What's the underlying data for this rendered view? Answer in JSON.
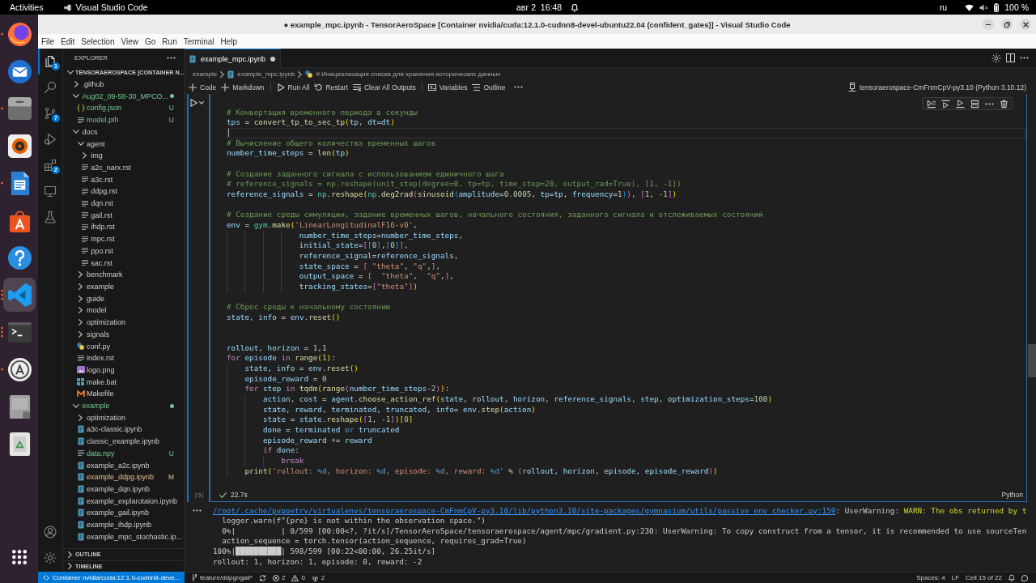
{
  "top_bar": {
    "activities": "Activities",
    "app_name": "Visual Studio Code",
    "clock": "авг 2  16:48",
    "input_source": "ru",
    "battery": "100 %"
  },
  "dock": {
    "apps": [
      {
        "selected": false,
        "running": true,
        "multiple_windows": false
      },
      {
        "selected": false,
        "running": false,
        "multiple_windows": false
      },
      {
        "selected": false,
        "running": true,
        "multiple_windows": false
      },
      {
        "selected": false,
        "running": false,
        "multiple_windows": false
      },
      {
        "selected": false,
        "running": true,
        "multiple_windows": false
      },
      {
        "selected": false,
        "running": false,
        "multiple_windows": false
      },
      {
        "selected": false,
        "running": false,
        "multiple_windows": false
      },
      {
        "selected": true,
        "running": true,
        "multiple_windows": true
      },
      {
        "selected": false,
        "running": true,
        "multiple_windows": true
      },
      {
        "selected": false,
        "running": true,
        "multiple_windows": false
      },
      {
        "selected": false,
        "running": false,
        "multiple_windows": false
      },
      {
        "selected": false,
        "running": false,
        "multiple_windows": false
      }
    ]
  },
  "window": {
    "title": "● example_mpc.ipynb - TensorAeroSpace [Container nvidia/cuda:12.1.0-cudnn8-devel-ubuntu22.04 (confident_gates)] - Visual Studio Code"
  },
  "menu_bar": [
    "File",
    "Edit",
    "Selection",
    "View",
    "Go",
    "Run",
    "Terminal",
    "Help"
  ],
  "activity_bar": {
    "items": [
      {
        "selected": true,
        "badge": "1"
      },
      {
        "selected": false
      },
      {
        "selected": false,
        "badge": "7"
      },
      {
        "selected": false
      },
      {
        "selected": false,
        "badge": "2"
      },
      {
        "selected": false
      },
      {
        "selected": false
      }
    ]
  },
  "explorer": {
    "title": "EXPLORER",
    "tree": [
      {
        "label": "TENSORAEROSPACE [CONTAINER N...",
        "kind": "root",
        "expanded": true,
        "children": [
          {
            "label": ".github",
            "kind": "folder",
            "expanded": false
          },
          {
            "label": "Aug02_09-58-30_MPCO...",
            "kind": "folder",
            "expanded": true,
            "untracked": true,
            "children": [
              {
                "label": "config.json",
                "kind": "json",
                "untracked": true,
                "decoration": "U"
              },
              {
                "label": "model.pth",
                "kind": "text",
                "untracked": true,
                "decoration": "U"
              }
            ]
          },
          {
            "label": "docs",
            "kind": "folder",
            "expanded": true,
            "children": [
              {
                "label": "agent",
                "kind": "folder",
                "expanded": true,
                "children": [
                  {
                    "label": "img",
                    "kind": "folder",
                    "expanded": false
                  },
                  {
                    "label": "a2c_narx.rst",
                    "kind": "text"
                  },
                  {
                    "label": "a3c.rst",
                    "kind": "text"
                  },
                  {
                    "label": "ddpg.rst",
                    "kind": "text"
                  },
                  {
                    "label": "dqn.rst",
                    "kind": "text"
                  },
                  {
                    "label": "gail.rst",
                    "kind": "text"
                  },
                  {
                    "label": "ihdp.rst",
                    "kind": "text"
                  },
                  {
                    "label": "mpc.rst",
                    "kind": "text"
                  },
                  {
                    "label": "ppo.rst",
                    "kind": "text"
                  },
                  {
                    "label": "sac.rst",
                    "kind": "text"
                  }
                ]
              },
              {
                "label": "benchmark",
                "kind": "folder",
                "expanded": false
              },
              {
                "label": "example",
                "kind": "folder",
                "expanded": false
              },
              {
                "label": "guide",
                "kind": "folder",
                "expanded": false
              },
              {
                "label": "model",
                "kind": "folder",
                "expanded": false
              },
              {
                "label": "optimization",
                "kind": "folder",
                "expanded": false
              },
              {
                "label": "signals",
                "kind": "folder",
                "expanded": false
              },
              {
                "label": "conf.py",
                "kind": "python"
              },
              {
                "label": "index.rst",
                "kind": "text"
              },
              {
                "label": "logo.png",
                "kind": "image"
              },
              {
                "label": "make.bat",
                "kind": "windows"
              },
              {
                "label": "Makefile",
                "kind": "make"
              }
            ]
          },
          {
            "label": "example",
            "kind": "folder",
            "expanded": true,
            "untracked": true,
            "children": [
              {
                "label": "optimization",
                "kind": "folder",
                "expanded": false
              },
              {
                "label": "a3c-classic.ipynb",
                "kind": "notebook"
              },
              {
                "label": "classic_example.ipynb",
                "kind": "notebook"
              },
              {
                "label": "data.npy",
                "kind": "text",
                "untracked": true,
                "decoration": "U"
              },
              {
                "label": "example_a2c.ipynb",
                "kind": "notebook"
              },
              {
                "label": "example_ddpg.ipynb",
                "kind": "notebook",
                "modified": true,
                "decoration": "M"
              },
              {
                "label": "example_dqn.ipynb",
                "kind": "notebook"
              },
              {
                "label": "example_explarotaion.ipynb",
                "kind": "notebook"
              },
              {
                "label": "example_gail.ipynb",
                "kind": "notebook"
              },
              {
                "label": "example_ihdp.ipynb",
                "kind": "notebook"
              },
              {
                "label": "example_mpc_stochastic.ip...",
                "kind": "notebook"
              }
            ]
          }
        ]
      }
    ],
    "sections": [
      {
        "label": "OUTLINE",
        "expanded": false
      },
      {
        "label": "TIMELINE",
        "expanded": false
      }
    ]
  },
  "editor": {
    "tabs": [
      {
        "label": "example_mpc.ipynb",
        "selected": true,
        "dirty": true
      }
    ],
    "breadcrumb": [
      {
        "label": "example",
        "kind": "folder"
      },
      {
        "label": "example_mpc.ipynb",
        "kind": "notebook"
      },
      {
        "label": "# Инициализация списка для хранения исторических данных",
        "kind": "cell"
      }
    ],
    "toolbar": {
      "groups": [
        [
          "Code",
          "Markdown"
        ],
        [
          "Run All",
          "Restart",
          "Clear All Outputs"
        ],
        [
          "Variables",
          "Outline"
        ]
      ],
      "kernel": "tensoraerospace-CmFnmCpV-py3.10 (Python 3.10.12)"
    },
    "cell": {
      "execution_count": "[9]",
      "succeeded": true,
      "duration": "22.7s",
      "language": "Python",
      "lines": [
        {
          "kind": "code",
          "segments": [
            {
              "kind": "comment",
              "text": "# Конвертация временного периода в секунды"
            }
          ]
        },
        {
          "kind": "code",
          "segments": [
            {
              "kind": "name",
              "text": "tps"
            },
            {
              "kind": "plain",
              "text": " = "
            },
            {
              "kind": "func",
              "text": "convert_tp_to_sec_tp"
            },
            {
              "kind": "bracket1",
              "text": "("
            },
            {
              "kind": "name",
              "text": "tp"
            },
            {
              "kind": "plain",
              "text": ", "
            },
            {
              "kind": "name",
              "text": "dt"
            },
            {
              "kind": "plain",
              "text": "="
            },
            {
              "kind": "name",
              "text": "dt"
            },
            {
              "kind": "bracket1",
              "text": ")"
            }
          ]
        },
        {
          "kind": "current"
        },
        {
          "kind": "code",
          "segments": [
            {
              "kind": "comment",
              "text": "# Вычисление общего количества временных шагов"
            }
          ]
        },
        {
          "kind": "code",
          "segments": [
            {
              "kind": "name",
              "text": "number_time_steps"
            },
            {
              "kind": "plain",
              "text": " = "
            },
            {
              "kind": "func",
              "text": "len"
            },
            {
              "kind": "bracket1",
              "text": "("
            },
            {
              "kind": "name",
              "text": "tp"
            },
            {
              "kind": "bracket1",
              "text": ")"
            }
          ]
        },
        {
          "kind": "blank"
        },
        {
          "kind": "code",
          "segments": [
            {
              "kind": "comment",
              "text": "# Создание заданного сигнала с использованием единичного шага"
            }
          ]
        },
        {
          "kind": "code",
          "segments": [
            {
              "kind": "comment",
              "text": "# reference_signals = np.reshape(unit_step(degree=0, tp=tp, time_step=20, output_rad=True), [1, -1])"
            }
          ]
        },
        {
          "kind": "code",
          "segments": [
            {
              "kind": "name",
              "text": "reference_signals"
            },
            {
              "kind": "plain",
              "text": " = "
            },
            {
              "kind": "module",
              "text": "np"
            },
            {
              "kind": "plain",
              "text": "."
            },
            {
              "kind": "func",
              "text": "reshape"
            },
            {
              "kind": "bracket1",
              "text": "("
            },
            {
              "kind": "module",
              "text": "np"
            },
            {
              "kind": "plain",
              "text": "."
            },
            {
              "kind": "func",
              "text": "deg2rad"
            },
            {
              "kind": "bracket2",
              "text": "("
            },
            {
              "kind": "func",
              "text": "sinusoid"
            },
            {
              "kind": "bracket3",
              "text": "("
            },
            {
              "kind": "name",
              "text": "amplitude"
            },
            {
              "kind": "plain",
              "text": "="
            },
            {
              "kind": "number",
              "text": "0.0005"
            },
            {
              "kind": "plain",
              "text": ", "
            },
            {
              "kind": "name",
              "text": "tp"
            },
            {
              "kind": "plain",
              "text": "="
            },
            {
              "kind": "name",
              "text": "tp"
            },
            {
              "kind": "plain",
              "text": ", "
            },
            {
              "kind": "name",
              "text": "frequency"
            },
            {
              "kind": "plain",
              "text": "="
            },
            {
              "kind": "number",
              "text": "1"
            },
            {
              "kind": "bracket3",
              "text": ")"
            },
            {
              "kind": "bracket2",
              "text": ")"
            },
            {
              "kind": "plain",
              "text": ", "
            },
            {
              "kind": "bracket2",
              "text": "["
            },
            {
              "kind": "number",
              "text": "1"
            },
            {
              "kind": "plain",
              "text": ", -"
            },
            {
              "kind": "number",
              "text": "1"
            },
            {
              "kind": "bracket2",
              "text": "]"
            },
            {
              "kind": "bracket1",
              "text": ")"
            }
          ]
        },
        {
          "kind": "blank"
        },
        {
          "kind": "code",
          "segments": [
            {
              "kind": "comment",
              "text": "# Создание среды симуляции, задание временных шагов, начального состояния, заданного сигнала и отслеживаемых состояний"
            }
          ]
        },
        {
          "kind": "code",
          "segments": [
            {
              "kind": "name",
              "text": "env"
            },
            {
              "kind": "plain",
              "text": " = "
            },
            {
              "kind": "module",
              "text": "gym"
            },
            {
              "kind": "plain",
              "text": "."
            },
            {
              "kind": "func",
              "text": "make"
            },
            {
              "kind": "bracket1",
              "text": "("
            },
            {
              "kind": "string",
              "text": "'LinearLongitudinalF16-v0'"
            },
            {
              "kind": "plain",
              "text": ","
            }
          ]
        },
        {
          "kind": "code",
          "segments": [
            {
              "kind": "name",
              "text": "                number_time_steps"
            },
            {
              "kind": "plain",
              "text": "="
            },
            {
              "kind": "name",
              "text": "number_time_steps"
            },
            {
              "kind": "plain",
              "text": ","
            }
          ]
        },
        {
          "kind": "code",
          "segments": [
            {
              "kind": "name",
              "text": "                initial_state"
            },
            {
              "kind": "plain",
              "text": "="
            },
            {
              "kind": "bracket2",
              "text": "["
            },
            {
              "kind": "bracket3",
              "text": "["
            },
            {
              "kind": "number",
              "text": "0"
            },
            {
              "kind": "bracket3",
              "text": "]"
            },
            {
              "kind": "plain",
              "text": ","
            },
            {
              "kind": "bracket3",
              "text": "["
            },
            {
              "kind": "number",
              "text": "0"
            },
            {
              "kind": "bracket3",
              "text": "]"
            },
            {
              "kind": "bracket2",
              "text": "]"
            },
            {
              "kind": "plain",
              "text": ","
            }
          ]
        },
        {
          "kind": "code",
          "segments": [
            {
              "kind": "name",
              "text": "                reference_signal"
            },
            {
              "kind": "plain",
              "text": "="
            },
            {
              "kind": "name",
              "text": "reference_signals"
            },
            {
              "kind": "plain",
              "text": ","
            }
          ]
        },
        {
          "kind": "code",
          "segments": [
            {
              "kind": "name",
              "text": "                state_space"
            },
            {
              "kind": "plain",
              "text": " = "
            },
            {
              "kind": "bracket2",
              "text": "[ "
            },
            {
              "kind": "string",
              "text": "\"theta\""
            },
            {
              "kind": "plain",
              "text": ", "
            },
            {
              "kind": "string",
              "text": "\"q\""
            },
            {
              "kind": "plain",
              "text": ","
            },
            {
              "kind": "bracket2",
              "text": "]"
            },
            {
              "kind": "plain",
              "text": ","
            }
          ]
        },
        {
          "kind": "code",
          "segments": [
            {
              "kind": "name",
              "text": "                output_space"
            },
            {
              "kind": "plain",
              "text": " = "
            },
            {
              "kind": "bracket2",
              "text": "[  "
            },
            {
              "kind": "string",
              "text": "\"theta\""
            },
            {
              "kind": "plain",
              "text": ",  "
            },
            {
              "kind": "string",
              "text": "\"q\""
            },
            {
              "kind": "plain",
              "text": ","
            },
            {
              "kind": "bracket2",
              "text": "]"
            },
            {
              "kind": "plain",
              "text": ","
            }
          ]
        },
        {
          "kind": "code",
          "segments": [
            {
              "kind": "name",
              "text": "                tracking_states"
            },
            {
              "kind": "plain",
              "text": "="
            },
            {
              "kind": "bracket2",
              "text": "["
            },
            {
              "kind": "string",
              "text": "\"theta\""
            },
            {
              "kind": "bracket2",
              "text": "]"
            },
            {
              "kind": "bracket1",
              "text": ")"
            }
          ]
        },
        {
          "kind": "blank"
        },
        {
          "kind": "code",
          "segments": [
            {
              "kind": "comment",
              "text": "# Сброс среды к начальному состоянию"
            }
          ]
        },
        {
          "kind": "code",
          "segments": [
            {
              "kind": "name",
              "text": "state"
            },
            {
              "kind": "plain",
              "text": ", "
            },
            {
              "kind": "name",
              "text": "info"
            },
            {
              "kind": "plain",
              "text": " = "
            },
            {
              "kind": "name",
              "text": "env"
            },
            {
              "kind": "plain",
              "text": "."
            },
            {
              "kind": "func",
              "text": "reset"
            },
            {
              "kind": "bracket1",
              "text": "()"
            }
          ]
        },
        {
          "kind": "blank"
        },
        {
          "kind": "blank"
        },
        {
          "kind": "code",
          "segments": [
            {
              "kind": "name",
              "text": "rollout"
            },
            {
              "kind": "plain",
              "text": ", "
            },
            {
              "kind": "name",
              "text": "horizon"
            },
            {
              "kind": "plain",
              "text": " = "
            },
            {
              "kind": "number",
              "text": "1"
            },
            {
              "kind": "plain",
              "text": ","
            },
            {
              "kind": "number",
              "text": "1"
            }
          ]
        },
        {
          "kind": "code",
          "segments": [
            {
              "kind": "control",
              "text": "for "
            },
            {
              "kind": "name",
              "text": "episode "
            },
            {
              "kind": "control",
              "text": "in "
            },
            {
              "kind": "func",
              "text": "range"
            },
            {
              "kind": "bracket1",
              "text": "("
            },
            {
              "kind": "number",
              "text": "1"
            },
            {
              "kind": "bracket1",
              "text": ")"
            },
            {
              "kind": "plain",
              "text": ":"
            }
          ]
        },
        {
          "kind": "code",
          "segments": [
            {
              "kind": "name",
              "text": "    state"
            },
            {
              "kind": "plain",
              "text": ", "
            },
            {
              "kind": "name",
              "text": "info"
            },
            {
              "kind": "plain",
              "text": " = "
            },
            {
              "kind": "name",
              "text": "env"
            },
            {
              "kind": "plain",
              "text": "."
            },
            {
              "kind": "func",
              "text": "reset"
            },
            {
              "kind": "bracket1",
              "text": "()"
            }
          ]
        },
        {
          "kind": "code",
          "segments": [
            {
              "kind": "name",
              "text": "    episode_reward"
            },
            {
              "kind": "plain",
              "text": " = "
            },
            {
              "kind": "number",
              "text": "0"
            }
          ]
        },
        {
          "kind": "code",
          "segments": [
            {
              "kind": "control",
              "text": "    for "
            },
            {
              "kind": "name",
              "text": "step "
            },
            {
              "kind": "control",
              "text": "in "
            },
            {
              "kind": "func",
              "text": "tqdm"
            },
            {
              "kind": "bracket1",
              "text": "("
            },
            {
              "kind": "func",
              "text": "range"
            },
            {
              "kind": "bracket2",
              "text": "("
            },
            {
              "kind": "name",
              "text": "number_time_steps"
            },
            {
              "kind": "plain",
              "text": "-"
            },
            {
              "kind": "number",
              "text": "2"
            },
            {
              "kind": "bracket2",
              "text": ")"
            },
            {
              "kind": "bracket1",
              "text": ")"
            },
            {
              "kind": "plain",
              "text": ":"
            }
          ]
        },
        {
          "kind": "code",
          "segments": [
            {
              "kind": "name",
              "text": "        action"
            },
            {
              "kind": "plain",
              "text": ", "
            },
            {
              "kind": "name",
              "text": "cost"
            },
            {
              "kind": "plain",
              "text": " = "
            },
            {
              "kind": "name",
              "text": "agent"
            },
            {
              "kind": "plain",
              "text": "."
            },
            {
              "kind": "func",
              "text": "choose_action_ref"
            },
            {
              "kind": "bracket1",
              "text": "("
            },
            {
              "kind": "name",
              "text": "state"
            },
            {
              "kind": "plain",
              "text": ", "
            },
            {
              "kind": "name",
              "text": "rollout"
            },
            {
              "kind": "plain",
              "text": ", "
            },
            {
              "kind": "name",
              "text": "horizon"
            },
            {
              "kind": "plain",
              "text": ", "
            },
            {
              "kind": "name",
              "text": "reference_signals"
            },
            {
              "kind": "plain",
              "text": ", "
            },
            {
              "kind": "name",
              "text": "step"
            },
            {
              "kind": "plain",
              "text": ", "
            },
            {
              "kind": "name",
              "text": "optimization_steps"
            },
            {
              "kind": "plain",
              "text": "="
            },
            {
              "kind": "number",
              "text": "100"
            },
            {
              "kind": "bracket1",
              "text": ")"
            }
          ]
        },
        {
          "kind": "code",
          "segments": [
            {
              "kind": "name",
              "text": "        state"
            },
            {
              "kind": "plain",
              "text": ", "
            },
            {
              "kind": "name",
              "text": "reward"
            },
            {
              "kind": "plain",
              "text": ", "
            },
            {
              "kind": "name",
              "text": "terminated"
            },
            {
              "kind": "plain",
              "text": ", "
            },
            {
              "kind": "name",
              "text": "truncated"
            },
            {
              "kind": "plain",
              "text": ", "
            },
            {
              "kind": "name",
              "text": "info"
            },
            {
              "kind": "plain",
              "text": "= "
            },
            {
              "kind": "name",
              "text": "env"
            },
            {
              "kind": "plain",
              "text": "."
            },
            {
              "kind": "func",
              "text": "step"
            },
            {
              "kind": "bracket1",
              "text": "("
            },
            {
              "kind": "name",
              "text": "action"
            },
            {
              "kind": "bracket1",
              "text": ")"
            }
          ]
        },
        {
          "kind": "code",
          "segments": [
            {
              "kind": "name",
              "text": "        state"
            },
            {
              "kind": "plain",
              "text": " = "
            },
            {
              "kind": "name",
              "text": "state"
            },
            {
              "kind": "plain",
              "text": "."
            },
            {
              "kind": "func",
              "text": "reshape"
            },
            {
              "kind": "bracket1",
              "text": "("
            },
            {
              "kind": "bracket2",
              "text": "["
            },
            {
              "kind": "number",
              "text": "1"
            },
            {
              "kind": "plain",
              "text": ", -"
            },
            {
              "kind": "number",
              "text": "1"
            },
            {
              "kind": "bracket2",
              "text": "]"
            },
            {
              "kind": "bracket1",
              "text": ")["
            },
            {
              "kind": "number",
              "text": "0"
            },
            {
              "kind": "bracket1",
              "text": "]"
            }
          ]
        },
        {
          "kind": "code",
          "segments": [
            {
              "kind": "name",
              "text": "        done"
            },
            {
              "kind": "plain",
              "text": " = "
            },
            {
              "kind": "name",
              "text": "terminated "
            },
            {
              "kind": "keyword",
              "text": "or "
            },
            {
              "kind": "name",
              "text": "truncated"
            }
          ]
        },
        {
          "kind": "code",
          "segments": [
            {
              "kind": "name",
              "text": "        episode_reward"
            },
            {
              "kind": "plain",
              "text": " += "
            },
            {
              "kind": "name",
              "text": "reward"
            }
          ]
        },
        {
          "kind": "code",
          "segments": [
            {
              "kind": "control",
              "text": "        if "
            },
            {
              "kind": "name",
              "text": "done"
            },
            {
              "kind": "plain",
              "text": ":"
            }
          ]
        },
        {
          "kind": "code",
          "segments": [
            {
              "kind": "control",
              "text": "            break"
            }
          ]
        },
        {
          "kind": "code",
          "segments": [
            {
              "kind": "func",
              "text": "    print"
            },
            {
              "kind": "bracket1",
              "text": "("
            },
            {
              "kind": "string",
              "text": "'rollout: "
            },
            {
              "kind": "keyword",
              "text": "%d"
            },
            {
              "kind": "string",
              "text": ", horizon: "
            },
            {
              "kind": "keyword",
              "text": "%d"
            },
            {
              "kind": "string",
              "text": ", episode: "
            },
            {
              "kind": "keyword",
              "text": "%d"
            },
            {
              "kind": "string",
              "text": ", reward: "
            },
            {
              "kind": "keyword",
              "text": "%d"
            },
            {
              "kind": "string",
              "text": "'"
            },
            {
              "kind": "plain",
              "text": " % "
            },
            {
              "kind": "bracket2",
              "text": "("
            },
            {
              "kind": "name",
              "text": "rollout"
            },
            {
              "kind": "plain",
              "text": ", "
            },
            {
              "kind": "name",
              "text": "horizon"
            },
            {
              "kind": "plain",
              "text": ", "
            },
            {
              "kind": "name",
              "text": "episode"
            },
            {
              "kind": "plain",
              "text": ", "
            },
            {
              "kind": "name",
              "text": "episode_reward"
            },
            {
              "kind": "bracket2",
              "text": ")"
            },
            {
              "kind": "bracket1",
              "text": ")"
            }
          ]
        }
      ]
    },
    "output": {
      "lines": [
        {
          "segments": [
            {
              "kind": "link",
              "text": "/root/.cache/pypoetry/virtualenvs/tensoraerospace-CmFnmCpV-py3.10/lib/python3.10/site-packages/gymnasium/utils/passive_env_checker.py:159"
            },
            {
              "kind": "plain",
              "text": ": UserWarning: "
            },
            {
              "kind": "warning",
              "text": "WARN: The obs returned by t"
            }
          ]
        },
        {
          "segments": [
            {
              "kind": "plain",
              "text": "  logger.warn(f\"{pre} is not within the observation space.\")"
            }
          ]
        },
        {
          "segments": [
            {
              "kind": "plain",
              "text": "  0%|          | 0/599 [00:00<?, ?it/s]/TensorAeroSpace/tensoraerospace/agent/mpc/gradient.py:230: UserWarning: To copy construct from a tensor, it is recommended to use sourceTen"
            }
          ]
        },
        {
          "segments": [
            {
              "kind": "plain",
              "text": "  action_sequence = torch.tensor(action_sequence, requires_grad=True)"
            }
          ]
        },
        {
          "segments": [
            {
              "kind": "plain",
              "text": "100%|"
            },
            {
              "kind": "bar",
              "text": "██████████"
            },
            {
              "kind": "plain",
              "text": "| 598/599 [00:22<00:00, 26.25it/s]"
            }
          ]
        },
        {
          "segments": [
            {
              "kind": "plain",
              "text": "rollout: 1, horizon: 1, episode: 0, reward: -2"
            }
          ]
        }
      ]
    }
  },
  "status_bar": {
    "remote": "Container nvidia/cuda:12.1.0-cudnn8-deve...",
    "branch": "feature/ddpgngail*",
    "errors": "2",
    "warnings": "0",
    "ports": "2",
    "indicators": [
      "Spaces: 4",
      "LF",
      "Cell 15 of 22"
    ]
  }
}
